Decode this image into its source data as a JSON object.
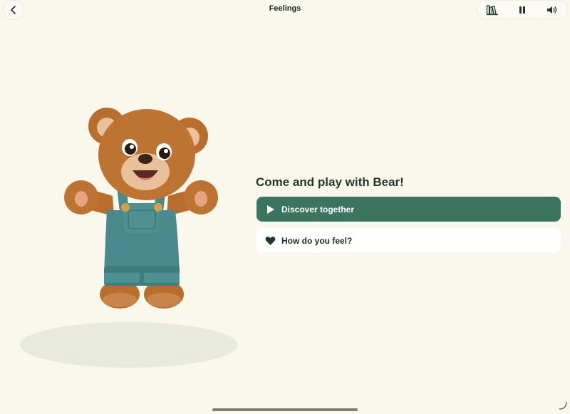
{
  "header": {
    "title": "Feelings"
  },
  "toolbar": {
    "icons": [
      "library-icon",
      "pause-icon",
      "speaker-icon"
    ]
  },
  "main": {
    "heading": "Come and play with Bear!",
    "primary_button": {
      "label": "Discover together",
      "icon": "play-icon"
    },
    "secondary_button": {
      "label": "How do you feel?",
      "icon": "heart-icon"
    }
  },
  "colors": {
    "background": "#faf8ed",
    "primary": "#3b7561",
    "text_dark": "#1f3a2d"
  }
}
